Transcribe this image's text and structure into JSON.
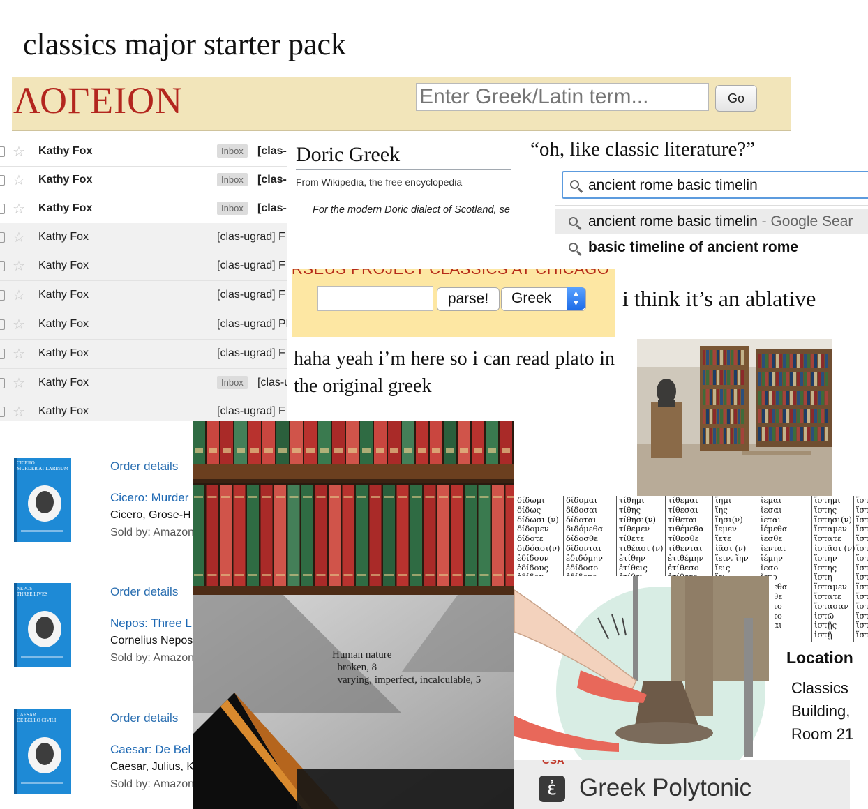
{
  "title": "classics major starter pack",
  "logeion": {
    "logo": "ΛΟΓΕΙΟΝ",
    "search_placeholder": "Enter Greek/Latin term...",
    "go_label": "Go"
  },
  "inbox": {
    "rows": [
      {
        "sender": "Kathy Fox",
        "label": "Inbox",
        "subject": "[clas-",
        "unread": true
      },
      {
        "sender": "Kathy Fox",
        "label": "Inbox",
        "subject": "[clas-",
        "unread": true
      },
      {
        "sender": "Kathy Fox",
        "label": "Inbox",
        "subject": "[clas-",
        "unread": true
      },
      {
        "sender": "Kathy Fox",
        "label": "",
        "subject": "[clas-ugrad] F",
        "unread": false
      },
      {
        "sender": "Kathy Fox",
        "label": "",
        "subject": "[clas-ugrad] F",
        "unread": false
      },
      {
        "sender": "Kathy Fox",
        "label": "",
        "subject": "[clas-ugrad] F",
        "unread": false
      },
      {
        "sender": "Kathy Fox",
        "label": "",
        "subject": "[clas-ugrad] Pl",
        "unread": false
      },
      {
        "sender": "Kathy Fox",
        "label": "",
        "subject": "[clas-ugrad] F",
        "unread": false
      },
      {
        "sender": "Kathy Fox",
        "label": "Inbox",
        "subject": "[clas-u",
        "unread": false
      },
      {
        "sender": "Kathy Fox",
        "label": "",
        "subject": "[clas-ugrad] F",
        "unread": false
      }
    ]
  },
  "wiki": {
    "title": "Doric Greek",
    "from": "From Wikipedia, the free encyclopedia",
    "hatnote": "For the modern Doric dialect of Scotland, se"
  },
  "quote": "“oh, like classic literature?”",
  "google": {
    "query": "ancient rome basic timelin",
    "suggestion1": "ancient rome basic timelin",
    "suggestion1_dash": " - ",
    "suggestion1_suffix": "Google Sear",
    "suggestion2": "basic timeline of ancient rome"
  },
  "perseus": {
    "header": "RSEUS PROJECT          CLASSICS AT CHICAGO",
    "parse_label": "parse!",
    "language": "Greek",
    "arrow_up": "▲",
    "arrow_down": "▼"
  },
  "ablative": "i think it’s an ablative",
  "plato": "haha yeah i’m here so i can read plato in the original greek",
  "orders": [
    {
      "link": "Order details",
      "title": "Cicero: Murder",
      "author": "Cicero, Grose-H",
      "sold": "Sold by: Amazon",
      "cover": "CICERO\nMURDER AT LARINUM"
    },
    {
      "link": "Order details",
      "title": "Nepos: Three L",
      "author": "Cornelius Nepos",
      "sold": "Sold by: Amazon",
      "cover": "NEPOS\nTHREE LIVES"
    },
    {
      "link": "Order details",
      "title": "Caesar: De Bel",
      "author": "Caesar, Julius, K",
      "sold": "Sold by: Amazon",
      "cover": "CAESAR\nDE BELLO CIVILI"
    }
  ],
  "index_text": "Human nature\n  broken, 8\n  varying, imperfect, incalculable, 5",
  "greek_table": {
    "columns": [
      "δίδωμι\nδίδως\nδίδωσι (ν)\nδίδομεν\nδίδοτε\nδιδόασι(ν)\nἐδίδουν\nἐδίδους\nἐδίδου",
      "δίδομαι\nδίδοσαι\nδίδοται\nδιδόμεθα\nδίδοσθε\nδίδονται\nἐδιδόμην\nἐδίδοσο\nἐδίδοτο",
      "τίθημι\nτίθης\nτίθησι(ν)\nτίθεμεν\nτίθετε\nτιθέασι (ν)\nἐτίθην\nἐτίθεις\nἐτίθει",
      "τίθεμαι\nτίθεσαι\nτίθεται\nτιθέμεθα\nτίθεσθε\nτίθενται\nἐτιθέμην\nἐτίθεσο\nἐτίθετο",
      "ἵημι\nἵης\nἵησι(ν)\nἵεμεν\nἵετε\nἱᾶσι (ν)\nἵειν, ἵην\nἵεις\nἵει",
      "ἵεμαι\nἵεσαι\nἵεται\nἱέμεθα\nἵεσθε\nἵενται\nἱέμην\nἵεσο\nἵετο\nἵεμεθα\nἵεσθε\nἵεντο\nἵεντο\nἵεσαι",
      "ἵστημι\nἵστης\nἵστησι(ν)\nἵσταμεν\nἵστατε\nἱστᾶσι (ν)\nἵστην\nἵστης\nἵστη\nἵσταμεν\nἵστατε\nἵστασαν\nἱστῶ\nἱστῇς\nἱστῇ",
      "ἵστ\nἵστ\nἵστ\nἵστ\nἵστ\nἵστ\nἵστ\nἵστ\nἵστ\nἵστ\nἵστ\nἵστ\nἵστ\nἵστ\nἵστ"
    ]
  },
  "location": {
    "label": "Location",
    "value": "Classics Building, Room 21"
  },
  "polytonic": {
    "csa": "CSA",
    "icon_glyph": "ἐ",
    "text": "Greek Polytonic"
  },
  "colors": {
    "logeion_bg": "#f2e5ba",
    "logeion_logo": "#b3261e",
    "perseus_bg": "#fde7a3",
    "link_blue": "#2b6fb1",
    "amazon_cover_blue": "#1e8ad6"
  }
}
